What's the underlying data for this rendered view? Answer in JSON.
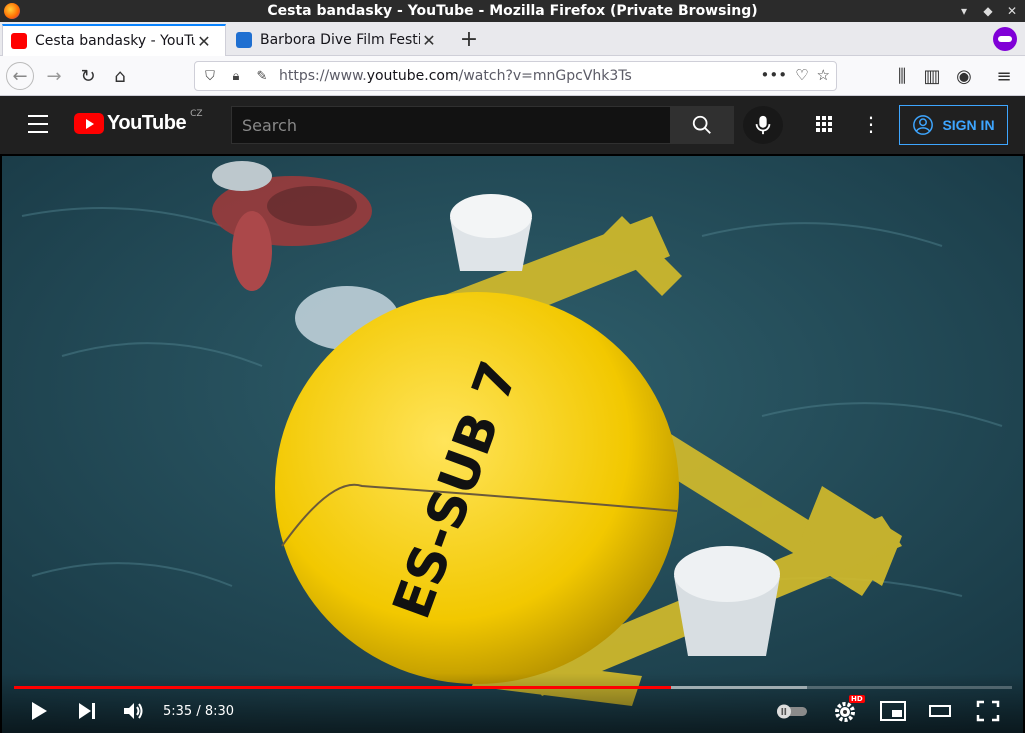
{
  "window": {
    "title": "Cesta bandasky - YouTube - Mozilla Firefox (Private Browsing)"
  },
  "tabs": [
    {
      "label": "Cesta bandasky - YouTube",
      "active": true,
      "favicon_color": "#ff0000"
    },
    {
      "label": "Barbora Dive Film Festival",
      "active": false,
      "favicon_color": "#1f6fd1"
    }
  ],
  "navbar": {
    "url_prefix": "https://www.",
    "url_domain": "youtube.com",
    "url_path": "/watch?v=mnGpcVhk3Ts"
  },
  "youtube": {
    "logo_text": "YouTube",
    "country_code": "CZ",
    "search_placeholder": "Search",
    "signin_label": "SIGN IN",
    "accent": "#3ea6ff"
  },
  "video": {
    "time_display": "5:35 / 8:30",
    "progress_fraction": 0.658,
    "buffer_fraction": 0.795,
    "buoy_label": "ES-SUB 7",
    "hd_badge": "HD"
  }
}
